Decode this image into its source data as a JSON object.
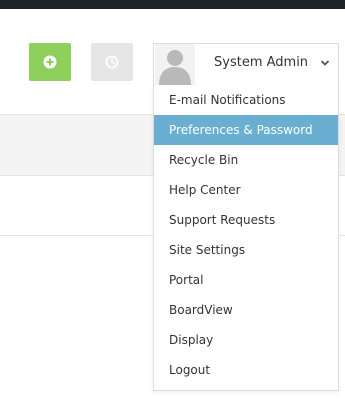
{
  "header": {
    "add_icon": "plus-circle-icon",
    "secondary_icon": "clock-icon"
  },
  "user_menu": {
    "user_name": "System Admin",
    "avatar_icon": "user-avatar-icon",
    "chevron_icon": "chevron-down-icon",
    "active_index": 1,
    "items": [
      {
        "label": "E-mail Notifications"
      },
      {
        "label": "Preferences & Password"
      },
      {
        "label": "Recycle Bin"
      },
      {
        "label": "Help Center"
      },
      {
        "label": "Support Requests"
      },
      {
        "label": "Site Settings"
      },
      {
        "label": "Portal"
      },
      {
        "label": "BoardView"
      },
      {
        "label": "Display"
      },
      {
        "label": "Logout"
      }
    ]
  },
  "colors": {
    "add_button": "#8fcf5d",
    "secondary_button": "#e6e6e6",
    "menu_active_bg": "#6aafd1",
    "top_bar": "#1f2326"
  }
}
